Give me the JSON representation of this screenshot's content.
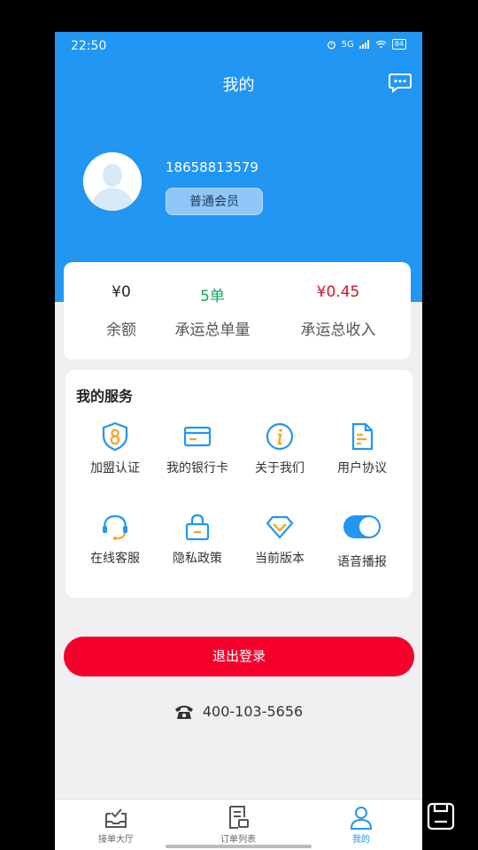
{
  "status_bar": {
    "time": "22:50",
    "signal": "5G",
    "battery": "84"
  },
  "header": {
    "title": "我的"
  },
  "profile": {
    "phone": "18658813579",
    "member_level": "普通会员"
  },
  "stats": [
    {
      "value": "¥0",
      "label": "余额",
      "color": "#222222"
    },
    {
      "value": "5单",
      "label": "承运总单量",
      "color": "#1aa35a"
    },
    {
      "value": "¥0.45",
      "label": "承运总收入",
      "color": "#d0142a"
    }
  ],
  "services": {
    "title": "我的服务",
    "items": [
      {
        "label": "加盟认证",
        "icon": "shield-badge-icon"
      },
      {
        "label": "我的银行卡",
        "icon": "bank-card-icon"
      },
      {
        "label": "关于我们",
        "icon": "info-icon"
      },
      {
        "label": "用户协议",
        "icon": "document-icon"
      },
      {
        "label": "在线客服",
        "icon": "headset-icon"
      },
      {
        "label": "隐私政策",
        "icon": "lock-icon"
      },
      {
        "label": "当前版本",
        "icon": "diamond-icon"
      },
      {
        "label": "语音播报",
        "icon": "toggle-icon",
        "toggle_on": true
      }
    ]
  },
  "logout_label": "退出登录",
  "hotline": "400-103-5656",
  "tabbar": {
    "items": [
      {
        "label": "接单大厅",
        "icon": "inbox-check-icon",
        "active": false
      },
      {
        "label": "订单列表",
        "icon": "order-list-icon",
        "active": false
      },
      {
        "label": "我的",
        "icon": "user-icon",
        "active": true
      }
    ]
  },
  "colors": {
    "primary": "#2196f3",
    "accent_orange": "#f5a623",
    "danger": "#f5002b"
  }
}
